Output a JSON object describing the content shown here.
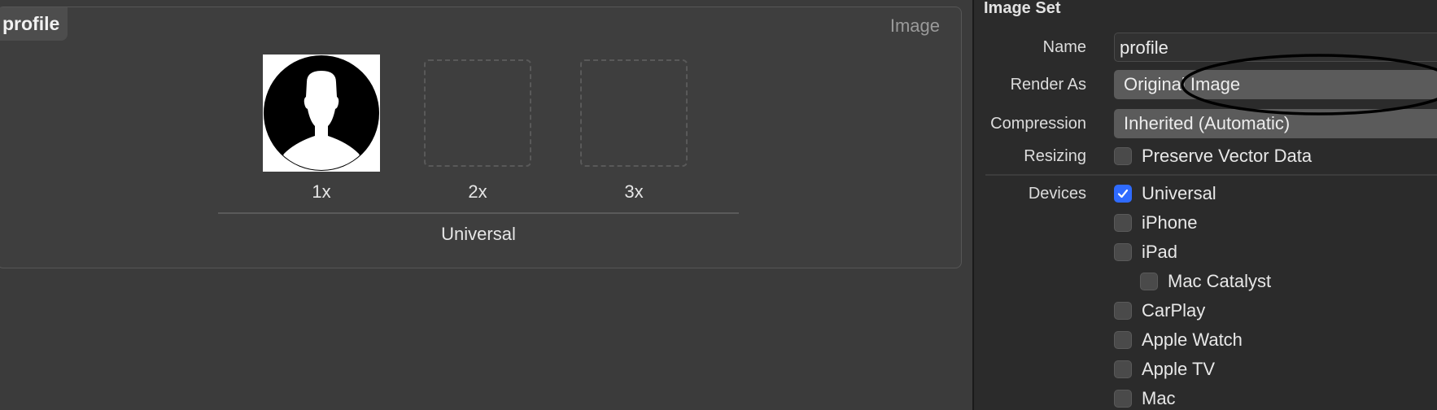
{
  "asset": {
    "name": "profile",
    "type_label": "Image",
    "slots": [
      {
        "scale": "1x",
        "filled": true
      },
      {
        "scale": "2x",
        "filled": false
      },
      {
        "scale": "3x",
        "filled": false
      }
    ],
    "idiom": "Universal"
  },
  "inspector": {
    "title": "Image Set",
    "name_label": "Name",
    "name_value": "profile",
    "render_as_label": "Render As",
    "render_as_value": "Original Image",
    "compression_label": "Compression",
    "compression_value": "Inherited (Automatic)",
    "resizing_label": "Resizing",
    "preserve_vector_label": "Preserve Vector Data",
    "preserve_vector_checked": false,
    "devices_label": "Devices",
    "devices": [
      {
        "label": "Universal",
        "checked": true
      },
      {
        "label": "iPhone",
        "checked": false
      },
      {
        "label": "iPad",
        "checked": false
      },
      {
        "label": "Mac Catalyst",
        "checked": false
      },
      {
        "label": "CarPlay",
        "checked": false
      },
      {
        "label": "Apple Watch",
        "checked": false
      },
      {
        "label": "Apple TV",
        "checked": false
      },
      {
        "label": "Mac",
        "checked": false
      }
    ]
  },
  "colors": {
    "accent": "#2f6bff",
    "canvas_bg": "#3b3b3b",
    "inspector_bg": "#2b2b2b"
  }
}
